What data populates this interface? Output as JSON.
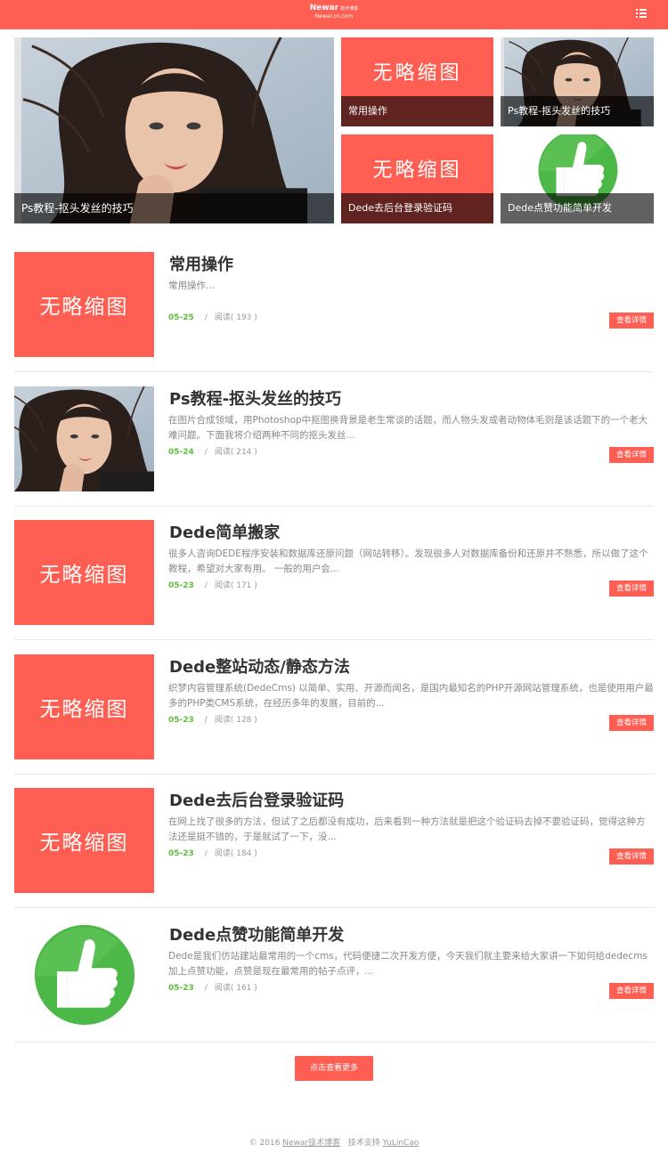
{
  "header": {
    "brand_name": "Newar",
    "brand_tag": "技术博客",
    "brand_url": "Newar.cn.com",
    "menu_icon": "list-icon"
  },
  "featured": [
    {
      "caption": "Ps教程-抠头发丝的技巧"
    },
    {
      "caption": "常用操作",
      "placeholder": "无略缩图"
    },
    {
      "caption": "Ps教程-抠头发丝的技巧"
    },
    {
      "caption": "Dede去后台登录验证码",
      "placeholder": "无略缩图"
    },
    {
      "caption": "Dede点赞功能简单开发"
    }
  ],
  "articles": [
    {
      "title": "常用操作",
      "desc": "常用操作...",
      "date": "05-25",
      "views": "阅读( 193 )",
      "more": "查看详情",
      "placeholder": "无略缩图"
    },
    {
      "title": "Ps教程-抠头发丝的技巧",
      "desc": "在图片合成领域，用Photoshop中抠图换背景是老生常谈的话题，而人物头发或者动物体毛则是该话题下的一个老大难问题。下面我将介绍两种不同的抠头发丝...",
      "date": "05-24",
      "views": "阅读( 214 )",
      "more": "查看详情"
    },
    {
      "title": "Dede简单搬家",
      "desc": "很多人咨询DEDE程序安装和数据库还原问题（网站转移）。发现很多人对数据库备份和还原并不熟悉，所以做了这个教程，希望对大家有用。 一般的用户会...",
      "date": "05-23",
      "views": "阅读( 171 )",
      "more": "查看详情",
      "placeholder": "无略缩图"
    },
    {
      "title": "Dede整站动态/静态方法",
      "desc": "织梦内容管理系统(DedeCms) 以简单、实用、开源而闻名，是国内最知名的PHP开源网站管理系统，也是使用用户最多的PHP类CMS系统，在经历多年的发展，目前的...",
      "date": "05-23",
      "views": "阅读( 128 )",
      "more": "查看详情",
      "placeholder": "无略缩图"
    },
    {
      "title": "Dede去后台登录验证码",
      "desc": "在网上找了很多的方法，但试了之后都没有成功，后来看到一种方法就是把这个验证码去掉不要验证码，觉得这种方法还是挺不错的，于是就试了一下，没...",
      "date": "05-23",
      "views": "阅读( 184 )",
      "more": "查看详情",
      "placeholder": "无略缩图"
    },
    {
      "title": "Dede点赞功能简单开发",
      "desc": "Dede是我们仿站建站最常用的一个cms，代码便捷二次开发方便，今天我们就主要来给大家讲一下如何给dedecms加上点赞功能，点赞是现在最常用的帖子点评，...",
      "date": "05-23",
      "views": "阅读( 161 )",
      "more": "查看详情"
    }
  ],
  "sep": "/",
  "load_more": "点击查看更多",
  "footer": {
    "copyright": "© 2016",
    "site_link": "Newar技术博客",
    "support_label": "技术支持",
    "author_link": "YuLinCao"
  },
  "colors": {
    "accent": "#ff5e52",
    "date": "#5cbd3a",
    "like_green": "#4cb848"
  }
}
